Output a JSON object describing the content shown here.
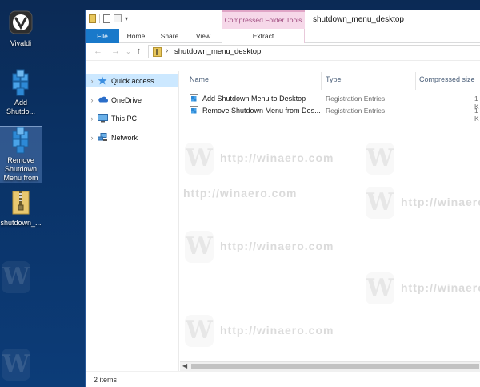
{
  "desktop": {
    "icons": [
      {
        "label": "Vivaldi",
        "icon": "vivaldi-icon"
      },
      {
        "label": "Add Shutdo...",
        "icon": "registry-icon"
      },
      {
        "label": "Remove Shutdown Menu from",
        "icon": "registry-icon"
      },
      {
        "label": "shutdown_...",
        "icon": "zip-folder-icon"
      }
    ]
  },
  "window": {
    "title": "shutdown_menu_desktop",
    "context_tab_group": "Compressed Folder Tools",
    "ribbon_tabs": [
      "File",
      "Home",
      "Share",
      "View"
    ],
    "context_tab": "Extract"
  },
  "address": {
    "path": "shutdown_menu_desktop"
  },
  "nav_pane": [
    {
      "label": "Quick access",
      "icon": "star-icon",
      "selected": true
    },
    {
      "label": "OneDrive",
      "icon": "cloud-icon",
      "selected": false
    },
    {
      "label": "This PC",
      "icon": "computer-icon",
      "selected": false
    },
    {
      "label": "Network",
      "icon": "network-icon",
      "selected": false
    }
  ],
  "columns": {
    "name": "Name",
    "type": "Type",
    "compressed_size": "Compressed size"
  },
  "files": [
    {
      "name": "Add Shutdown Menu to Desktop",
      "type": "Registration Entries",
      "size": "1 K"
    },
    {
      "name": "Remove Shutdown Menu from Des...",
      "type": "Registration Entries",
      "size": "1 K"
    }
  ],
  "status": {
    "items": "2 items"
  },
  "watermark": {
    "text": "http://winaero.com"
  },
  "colors": {
    "accent": "#1979ca",
    "selection": "#cce8ff",
    "context_tab": "#f6d8e9",
    "desktop_bg": "#0a3266"
  }
}
